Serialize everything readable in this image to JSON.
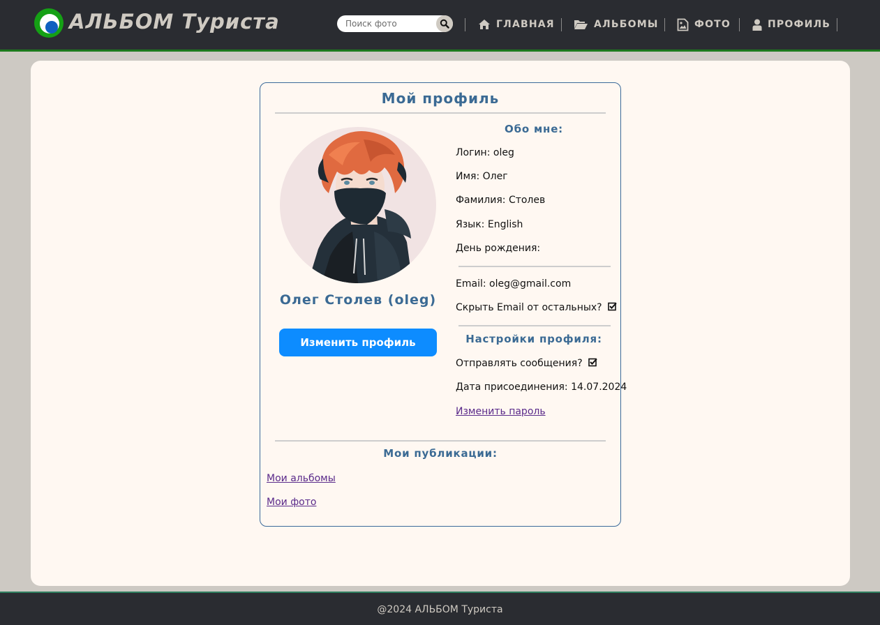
{
  "header": {
    "logo_text": "АЛЬБОМ Туриста",
    "search_placeholder": "Поиск фото",
    "nav": [
      {
        "label": "ГЛАВНАЯ",
        "icon": "home-icon"
      },
      {
        "label": "АЛЬБОМЫ",
        "icon": "folder-open-icon"
      },
      {
        "label": "ФОТО",
        "icon": "image-file-icon"
      },
      {
        "label": "ПРОФИЛЬ",
        "icon": "user-icon"
      }
    ]
  },
  "profile": {
    "title": "Мой профиль",
    "user_name": "Олег Столев (oleg)",
    "edit_button": "Изменить профиль",
    "about_title": "Обо мне:",
    "login_label": "Логин:",
    "login_value": "oleg",
    "first_name_label": "Имя:",
    "first_name_value": "Олег",
    "last_name_label": "Фамилия:",
    "last_name_value": "Столев",
    "language_label": "Язык:",
    "language_value": "English",
    "birthday_label": "День рождения:",
    "birthday_value": "",
    "email_label": "Email:",
    "email_value": "oleg@gmail.com",
    "hide_email_label": "Скрыть Email от остальных?",
    "settings_title": "Настройки профиля:",
    "send_messages_label": "Отправлять сообщения?",
    "joined_label": "Дата присоединения:",
    "joined_value": "14.07.2024",
    "change_password_link": "Изменить пароль",
    "publications_title": "Мои публикации:",
    "my_albums_link": "Мои альбомы",
    "my_photos_link": "Мои фото"
  },
  "footer": {
    "copyright": "@2024 АЛЬБОМ Туриста"
  },
  "colors": {
    "header_bg": "#2a2c31",
    "accent_green": "#15a015",
    "title_blue": "#3b6a94",
    "button_blue": "#0d8cff",
    "page_bg": "#fff8f2"
  }
}
